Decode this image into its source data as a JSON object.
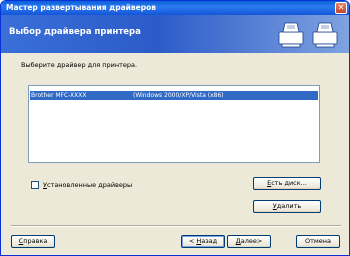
{
  "window": {
    "title": "Мастер развертывания драйверов",
    "close_glyph": "✕"
  },
  "header": {
    "title": "Выбор драйвера принтера",
    "icon": "printer-icon"
  },
  "main": {
    "prompt": "Выберите драйвер для принтера.",
    "drivers": [
      {
        "name": "Brother MFC-XXXX",
        "platform": "(Windows 2000/XP/Vista (x86)",
        "selected": true
      }
    ],
    "installed_checkbox": {
      "label_first": "У",
      "label_rest": "становленные драйверы",
      "checked": false
    },
    "have_disk_button": {
      "first": "Е",
      "rest": "сть диск..."
    },
    "delete_button": {
      "first": "У",
      "rest": "далить"
    }
  },
  "footer": {
    "help_button": {
      "first": "С",
      "rest": "правка"
    },
    "back_button": {
      "prefix": "< ",
      "first": "Н",
      "rest": "азад"
    },
    "next_button": {
      "first": "Д",
      "rest": "алее>"
    },
    "cancel_button": "Отмена"
  },
  "colors": {
    "titlebar": "#0a5fd8",
    "header": "#3a6fd8",
    "selection": "#316ac5",
    "dialog": "#ece9d8"
  }
}
